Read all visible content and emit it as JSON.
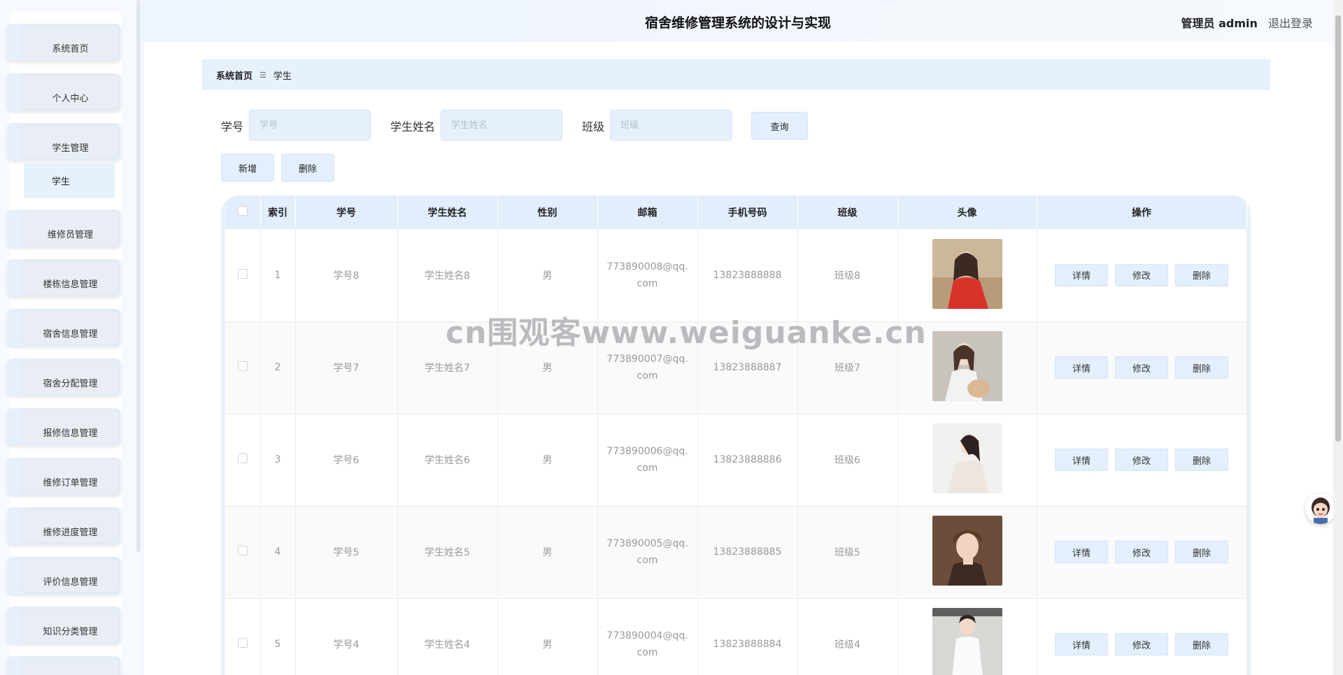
{
  "app": {
    "title": "宿舍维修管理系统的设计与实现",
    "user_role": "管理员 admin",
    "logout": "退出登录"
  },
  "sidebar": {
    "items": [
      {
        "label": "系统首页"
      },
      {
        "label": "个人中心"
      },
      {
        "label": "学生管理"
      },
      {
        "label": "维修员管理"
      },
      {
        "label": "楼栋信息管理"
      },
      {
        "label": "宿舍信息管理"
      },
      {
        "label": "宿舍分配管理"
      },
      {
        "label": "报修信息管理"
      },
      {
        "label": "维修订单管理"
      },
      {
        "label": "维修进度管理"
      },
      {
        "label": "评价信息管理"
      },
      {
        "label": "知识分类管理"
      }
    ],
    "submenu": {
      "label": "学生"
    }
  },
  "breadcrumb": {
    "home": "系统首页",
    "separator": "☰",
    "current": "学生"
  },
  "search": {
    "student_id_label": "学号",
    "student_id_placeholder": "学号",
    "student_name_label": "学生姓名",
    "student_name_placeholder": "学生姓名",
    "class_label": "班级",
    "class_placeholder": "班级",
    "query_button": "查询"
  },
  "actions": {
    "add": "新增",
    "delete": "删除"
  },
  "table": {
    "headers": [
      "索引",
      "学号",
      "学生姓名",
      "性别",
      "邮箱",
      "手机号码",
      "班级",
      "头像",
      "操作"
    ],
    "rows": [
      {
        "index": "1",
        "student_id": "学号8",
        "name": "学生姓名8",
        "gender": "男",
        "email": "773890008@qq.com",
        "phone": "13823888888",
        "class": "班级8"
      },
      {
        "index": "2",
        "student_id": "学号7",
        "name": "学生姓名7",
        "gender": "男",
        "email": "773890007@qq.com",
        "phone": "13823888887",
        "class": "班级7"
      },
      {
        "index": "3",
        "student_id": "学号6",
        "name": "学生姓名6",
        "gender": "男",
        "email": "773890006@qq.com",
        "phone": "13823888886",
        "class": "班级6"
      },
      {
        "index": "4",
        "student_id": "学号5",
        "name": "学生姓名5",
        "gender": "男",
        "email": "773890005@qq.com",
        "phone": "13823888885",
        "class": "班级5"
      },
      {
        "index": "5",
        "student_id": "学号4",
        "name": "学生姓名4",
        "gender": "男",
        "email": "773890004@qq.com",
        "phone": "13823888884",
        "class": "班级4"
      }
    ],
    "row_actions": {
      "detail": "详情",
      "edit": "修改",
      "delete": "删除"
    }
  },
  "watermark": "cn围观客www.weiguanke.cn"
}
